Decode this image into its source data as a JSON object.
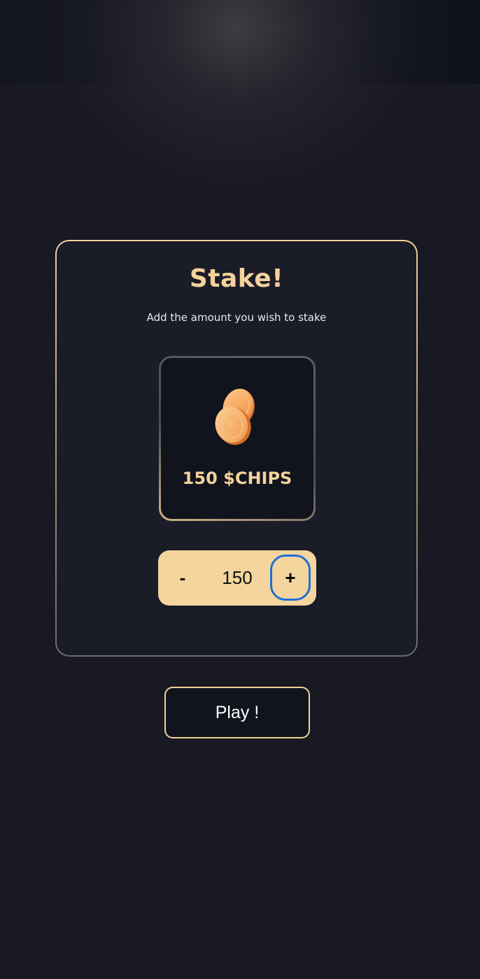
{
  "stake_panel": {
    "title": "Stake!",
    "subtitle": "Add the amount you wish to stake",
    "chip_display": {
      "icon": "coins-icon",
      "amount_label": "150 $CHIPS"
    },
    "stepper": {
      "decrement_label": "-",
      "value": "150",
      "increment_label": "+"
    }
  },
  "play_button": {
    "label": "Play !"
  },
  "colors": {
    "background": "#181923",
    "accent_gold": "#f3d29b",
    "stepper_bg": "#f4d59d",
    "focus_ring": "#1f6fd6"
  }
}
